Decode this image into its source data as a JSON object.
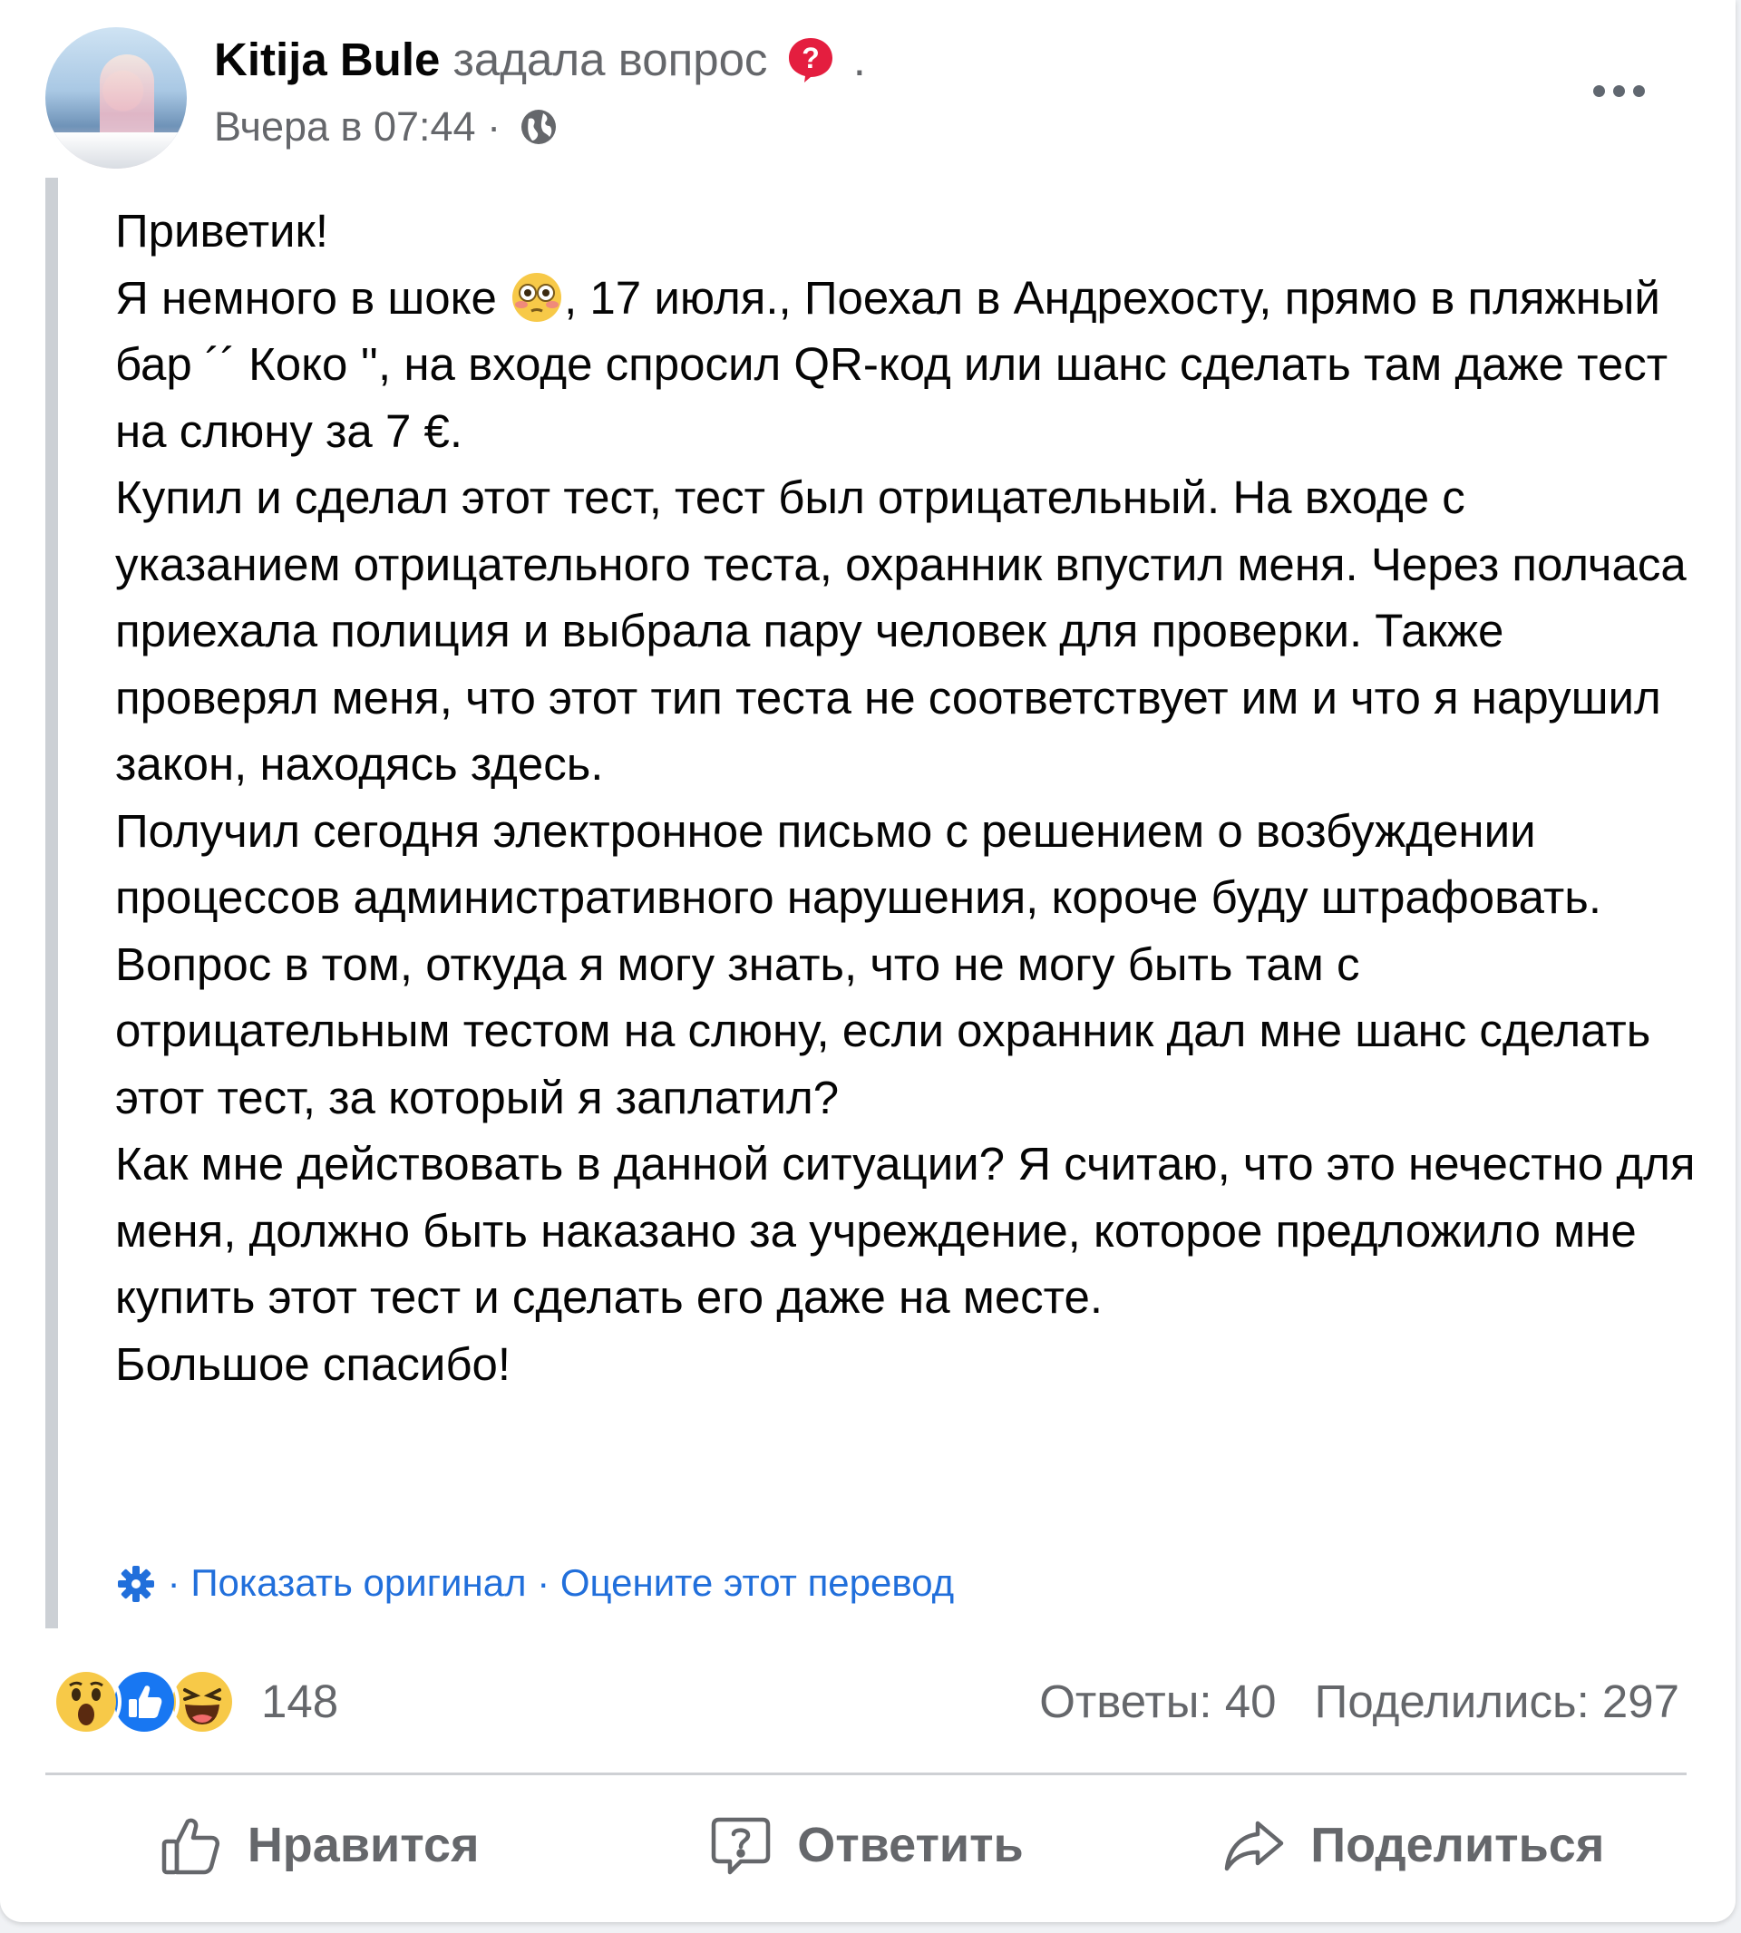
{
  "post": {
    "author": "Kitija Bule",
    "action": "задала вопрос",
    "trailing_dot": ".",
    "timestamp": "Вчера в 07:44",
    "meta_separator": "·",
    "paragraphs": [
      "Приветик!",
      "Купил и сделал этот тест, тест был отрицательный. На входе с указанием отрицательного теста, охранник впустил меня. Через полчаса приехала полиция и выбрала пару человек для проверки. Также проверял меня, что этот тип теста не соответствует им и что я нарушил закон, находясь здесь.",
      "Получил сегодня электронное письмо с решением о возбуждении процессов административного нарушения, короче буду штрафовать.",
      "Вопрос в том, откуда я могу знать, что не могу быть там с отрицательным тестом на слюну, если охранник дал мне шанс сделать этот тест, за который я заплатил?",
      "Как мне действовать в данной ситуации? Я считаю, что это нечестно для меня, должно быть наказано за учреждение, которое предложило мне купить этот тест и сделать его даже на месте.",
      "Большое спасибо!"
    ],
    "line2_before_emoji": "Я немного в шоке ",
    "line2_after_emoji": ", 17 июля., Поехал в Андрехосту, прямо в пляжный бар ´´ Коко '', на входе спросил QR-код или шанс сделать там даже тест на слюну за 7 €.",
    "translation": {
      "show_original": "Показать оригинал",
      "rate_translation": "Оцените этот перевод",
      "separator": " · "
    }
  },
  "stats": {
    "reactions": [
      "wow",
      "like",
      "haha"
    ],
    "reaction_count": "148",
    "answers": "Ответы: 40",
    "shares": "Поделились: 297"
  },
  "actions": {
    "like": "Нравится",
    "answer": "Ответить",
    "share": "Поделиться"
  },
  "colors": {
    "link": "#216fdb",
    "secondary_text": "#65676b",
    "question_badge": "#e41e3f"
  }
}
